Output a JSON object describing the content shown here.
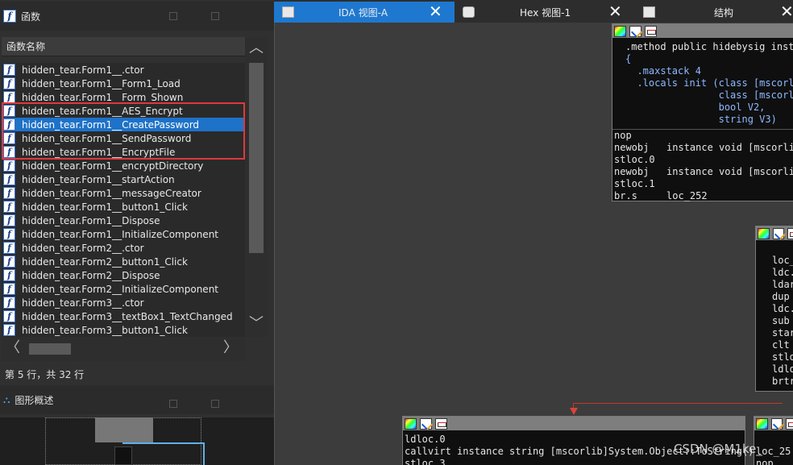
{
  "functions_panel": {
    "title": "函数",
    "column_header": "函数名称",
    "items": [
      "hidden_tear.Form1__.ctor",
      "hidden_tear.Form1__Form1_Load",
      "hidden_tear.Form1__Form_Shown",
      "hidden_tear.Form1__AES_Encrypt",
      "hidden_tear.Form1__CreatePassword",
      "hidden_tear.Form1__SendPassword",
      "hidden_tear.Form1__EncryptFile",
      "hidden_tear.Form1__encryptDirectory",
      "hidden_tear.Form1__startAction",
      "hidden_tear.Form1__messageCreator",
      "hidden_tear.Form1__button1_Click",
      "hidden_tear.Form1__Dispose",
      "hidden_tear.Form1__InitializeComponent",
      "hidden_tear.Form2__.ctor",
      "hidden_tear.Form2__button1_Click",
      "hidden_tear.Form2__Dispose",
      "hidden_tear.Form2__InitializeComponent",
      "hidden_tear.Form3__.ctor",
      "hidden_tear.Form3__textBox1_TextChanged",
      "hidden_tear.Form3__button1_Click"
    ],
    "selected_index": 4,
    "status": "第 5 行，共 32 行"
  },
  "overview_panel": {
    "title": "图形概述"
  },
  "tabs": [
    {
      "label": "IDA 视图-A",
      "active": true
    },
    {
      "label": "Hex 视图-1",
      "active": false
    },
    {
      "label": "结构",
      "active": false
    }
  ],
  "graph": {
    "node_main_header": [
      ".method public hidebysig insta",
      "{",
      "  .maxstack 4",
      "  .locals init (class [mscorli",
      "                class [mscorli",
      "                bool V2,",
      "                string V3)"
    ],
    "node_main_body": [
      "nop",
      "newobj   instance void [mscorlib",
      "stloc.0",
      "newobj   instance void [mscorlib",
      "stloc.1",
      "br.s     loc_252"
    ],
    "node_right_lines": [
      "loc_",
      "ldc.",
      "ldar",
      "dup",
      "ldc.",
      "sub",
      "star",
      "clt",
      "stlo",
      "ldlo",
      "brtr"
    ],
    "node_bottom_lines": [
      "ldloc.0",
      "callvirt instance string [mscorlib]System.Object::ToString()",
      "stloc.3"
    ],
    "node_bottom_right_lines": [
      "loc_25",
      "nop"
    ]
  },
  "watermark": "CSDN @M1ke_"
}
